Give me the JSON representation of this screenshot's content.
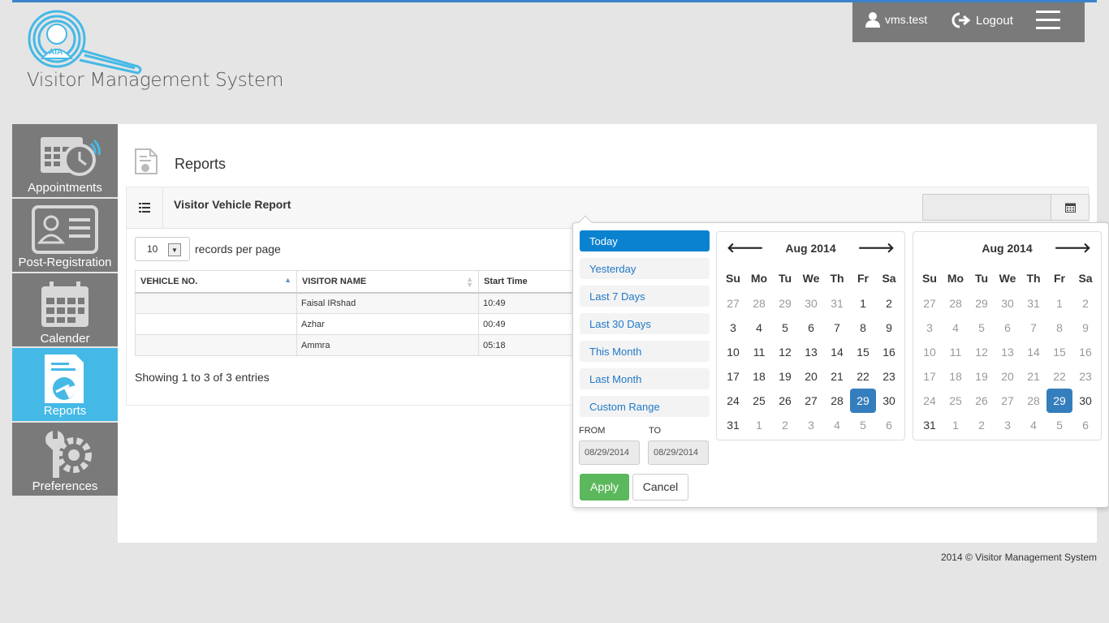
{
  "app": {
    "title": "Visitor Management System",
    "logo_mark": "AiA"
  },
  "userbar": {
    "username": "vms.test",
    "logout": "Logout"
  },
  "sidebar": {
    "items": [
      {
        "label": "Appointments",
        "icon": "calendar-clock-icon"
      },
      {
        "label": "Post-Registration",
        "icon": "id-card-icon"
      },
      {
        "label": "Calender",
        "icon": "calendar-icon"
      },
      {
        "label": "Reports",
        "icon": "report-chart-icon",
        "active": true
      },
      {
        "label": "Preferences",
        "icon": "wrench-gear-icon"
      }
    ]
  },
  "page": {
    "title": "Reports"
  },
  "panel": {
    "title": "Visitor Vehicle Report",
    "date_value": ""
  },
  "table": {
    "page_size": "10",
    "rpp_label": "records per page",
    "columns": [
      "VEHICLE NO.",
      "VISITOR NAME",
      "Start Time"
    ],
    "rows": [
      [
        "",
        "Faisal IRshad",
        "10:49"
      ],
      [
        "",
        "Azhar",
        "00:49"
      ],
      [
        "",
        "Ammra",
        "05:18"
      ]
    ],
    "showing": "Showing 1 to 3 of 3 entries"
  },
  "daterange": {
    "ranges": [
      "Today",
      "Yesterday",
      "Last 7 Days",
      "Last 30 Days",
      "This Month",
      "Last Month",
      "Custom Range"
    ],
    "active_range": "Today",
    "from_label": "FROM",
    "to_label": "TO",
    "from": "08/29/2014",
    "to": "08/29/2014",
    "apply": "Apply",
    "cancel": "Cancel",
    "weekdays": [
      "Su",
      "Mo",
      "Tu",
      "We",
      "Th",
      "Fr",
      "Sa"
    ],
    "left": {
      "month": "Aug 2014",
      "days": [
        [
          "27",
          "off"
        ],
        [
          "28",
          "off"
        ],
        [
          "29",
          "off"
        ],
        [
          "30",
          "off"
        ],
        [
          "31",
          "off"
        ],
        [
          "1",
          ""
        ],
        [
          "2",
          ""
        ],
        [
          "3",
          ""
        ],
        [
          "4",
          ""
        ],
        [
          "5",
          ""
        ],
        [
          "6",
          ""
        ],
        [
          "7",
          ""
        ],
        [
          "8",
          ""
        ],
        [
          "9",
          ""
        ],
        [
          "10",
          ""
        ],
        [
          "11",
          ""
        ],
        [
          "12",
          ""
        ],
        [
          "13",
          ""
        ],
        [
          "14",
          ""
        ],
        [
          "15",
          ""
        ],
        [
          "16",
          ""
        ],
        [
          "17",
          ""
        ],
        [
          "18",
          ""
        ],
        [
          "19",
          ""
        ],
        [
          "20",
          ""
        ],
        [
          "21",
          ""
        ],
        [
          "22",
          ""
        ],
        [
          "23",
          ""
        ],
        [
          "24",
          ""
        ],
        [
          "25",
          ""
        ],
        [
          "26",
          ""
        ],
        [
          "27",
          ""
        ],
        [
          "28",
          ""
        ],
        [
          "29",
          "sel"
        ],
        [
          "30",
          ""
        ],
        [
          "31",
          ""
        ],
        [
          "1",
          "off"
        ],
        [
          "2",
          "off"
        ],
        [
          "3",
          "off"
        ],
        [
          "4",
          "off"
        ],
        [
          "5",
          "off"
        ],
        [
          "6",
          "off"
        ]
      ]
    },
    "right": {
      "month": "Aug 2014",
      "days": [
        [
          "27",
          "off"
        ],
        [
          "28",
          "off"
        ],
        [
          "29",
          "off"
        ],
        [
          "30",
          "off"
        ],
        [
          "31",
          "off"
        ],
        [
          "1",
          "off"
        ],
        [
          "2",
          "off"
        ],
        [
          "3",
          "off"
        ],
        [
          "4",
          "off"
        ],
        [
          "5",
          "off"
        ],
        [
          "6",
          "off"
        ],
        [
          "7",
          "off"
        ],
        [
          "8",
          "off"
        ],
        [
          "9",
          "off"
        ],
        [
          "10",
          "off"
        ],
        [
          "11",
          "off"
        ],
        [
          "12",
          "off"
        ],
        [
          "13",
          "off"
        ],
        [
          "14",
          "off"
        ],
        [
          "15",
          "off"
        ],
        [
          "16",
          "off"
        ],
        [
          "17",
          "off"
        ],
        [
          "18",
          "off"
        ],
        [
          "19",
          "off"
        ],
        [
          "20",
          "off"
        ],
        [
          "21",
          "off"
        ],
        [
          "22",
          "off"
        ],
        [
          "23",
          "off"
        ],
        [
          "24",
          "off"
        ],
        [
          "25",
          "off"
        ],
        [
          "26",
          "off"
        ],
        [
          "27",
          "off"
        ],
        [
          "28",
          "off"
        ],
        [
          "29",
          "sel"
        ],
        [
          "30",
          ""
        ],
        [
          "31",
          ""
        ],
        [
          "1",
          "off"
        ],
        [
          "2",
          "off"
        ],
        [
          "3",
          "off"
        ],
        [
          "4",
          "off"
        ],
        [
          "5",
          "off"
        ],
        [
          "6",
          "off"
        ]
      ]
    }
  },
  "footer": "2014 © Visitor Management System",
  "colors": {
    "accent": "#45b9e6",
    "sidebar": "#7a7a7a",
    "apply": "#5cb85c",
    "range_active": "#0a82d0",
    "selected_day": "#357ebd"
  }
}
